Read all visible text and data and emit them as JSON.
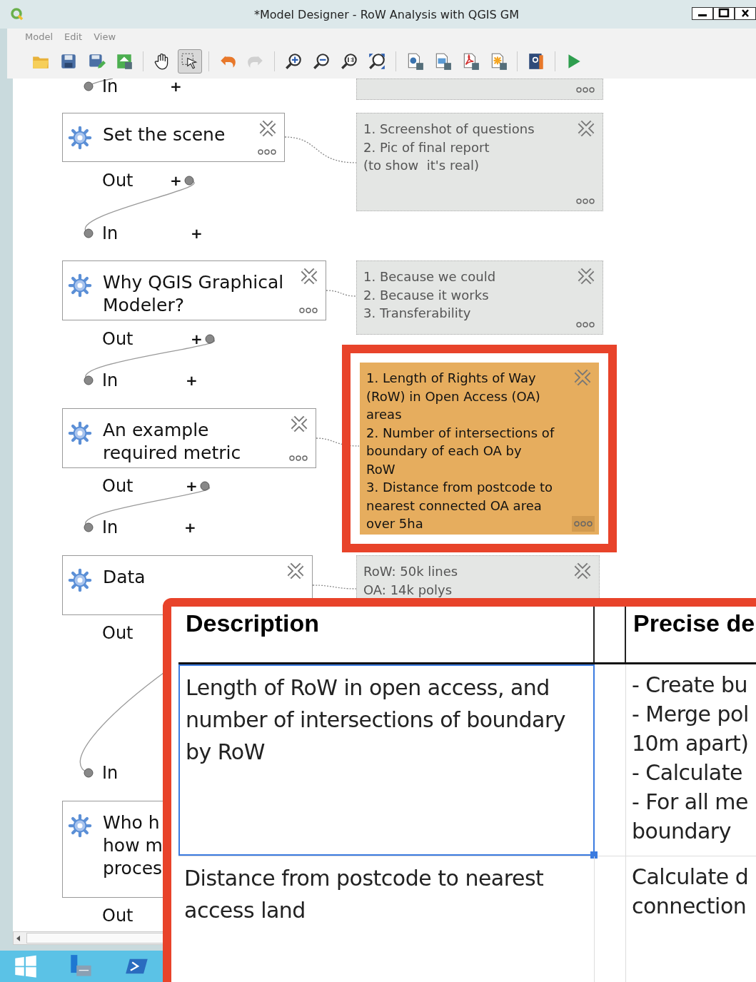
{
  "window": {
    "title": "*Model Designer - RoW Analysis with QGIS GM"
  },
  "menu": [
    {
      "label": "Model"
    },
    {
      "label": "Edit"
    },
    {
      "label": "View"
    }
  ],
  "toolbar": [
    {
      "kind": "open"
    },
    {
      "kind": "save"
    },
    {
      "kind": "save-as"
    },
    {
      "kind": "export"
    },
    {
      "kind": "pan",
      "selected": false
    },
    {
      "kind": "select",
      "selected": true
    },
    {
      "kind": "undo",
      "disabled": false
    },
    {
      "kind": "redo",
      "disabled": true
    },
    {
      "kind": "zoom-in"
    },
    {
      "kind": "zoom-out"
    },
    {
      "kind": "zoom-actual"
    },
    {
      "kind": "zoom-full"
    },
    {
      "kind": "export-python"
    },
    {
      "kind": "export-image"
    },
    {
      "kind": "export-pdf"
    },
    {
      "kind": "export-svg"
    },
    {
      "kind": "help"
    },
    {
      "kind": "run"
    }
  ],
  "canvas": {
    "ports": [
      {
        "kind": "in",
        "label": "In",
        "plus": "+"
      },
      {
        "kind": "out",
        "label": "Out",
        "plus": "+"
      },
      {
        "kind": "in",
        "label": "In",
        "plus": "+"
      },
      {
        "kind": "out",
        "label": "Out",
        "plus": "+"
      },
      {
        "kind": "in",
        "label": "In",
        "plus": "+"
      },
      {
        "kind": "out",
        "label": "Out",
        "plus": "+"
      },
      {
        "kind": "in",
        "label": "In",
        "plus": "+"
      },
      {
        "kind": "out",
        "label": "Out"
      },
      {
        "kind": "in",
        "label": "In"
      },
      {
        "kind": "out",
        "label": "Out"
      }
    ],
    "algorithms": [
      {
        "label": "Set the scene"
      },
      {
        "label": "Why QGIS Graphical\nModeler?"
      },
      {
        "label": "An example\nrequired metric"
      },
      {
        "label": "Data"
      },
      {
        "label": "Who h\nhow m\nproces"
      }
    ],
    "comments": [
      {
        "kind": "cut",
        "selected": false
      },
      {
        "kind": "full",
        "selected": false,
        "text": "1. Screenshot of questions\n2. Pic of final report\n(to show  it's real)"
      },
      {
        "kind": "full",
        "selected": false,
        "text": "1. Because we could\n2. Because it works\n3. Transferability"
      },
      {
        "kind": "full",
        "selected": true,
        "text": "1. Length of Rights of Way\n(RoW) in Open Access (OA)\nareas\n2. Number of intersections of\nboundary of each OA by\nRoW\n3. Distance from postcode to\nnearest connected OA area\nover 5ha"
      },
      {
        "kind": "full",
        "selected": false,
        "text": "RoW: 50k lines\nOA: 14k polys"
      }
    ]
  },
  "table": {
    "columns": [
      "Description",
      "Precise de"
    ],
    "rows": [
      {
        "selected": true,
        "description": "Length of RoW in open access, and number of intersections of boundary by RoW",
        "precise": "- Create bu\n- Merge pol\n10m apart)\n- Calculate\n- For all me\nboundary"
      },
      {
        "selected": false,
        "description": "Distance from postcode to nearest access land",
        "precise": "Calculate d\nconnection"
      }
    ]
  }
}
